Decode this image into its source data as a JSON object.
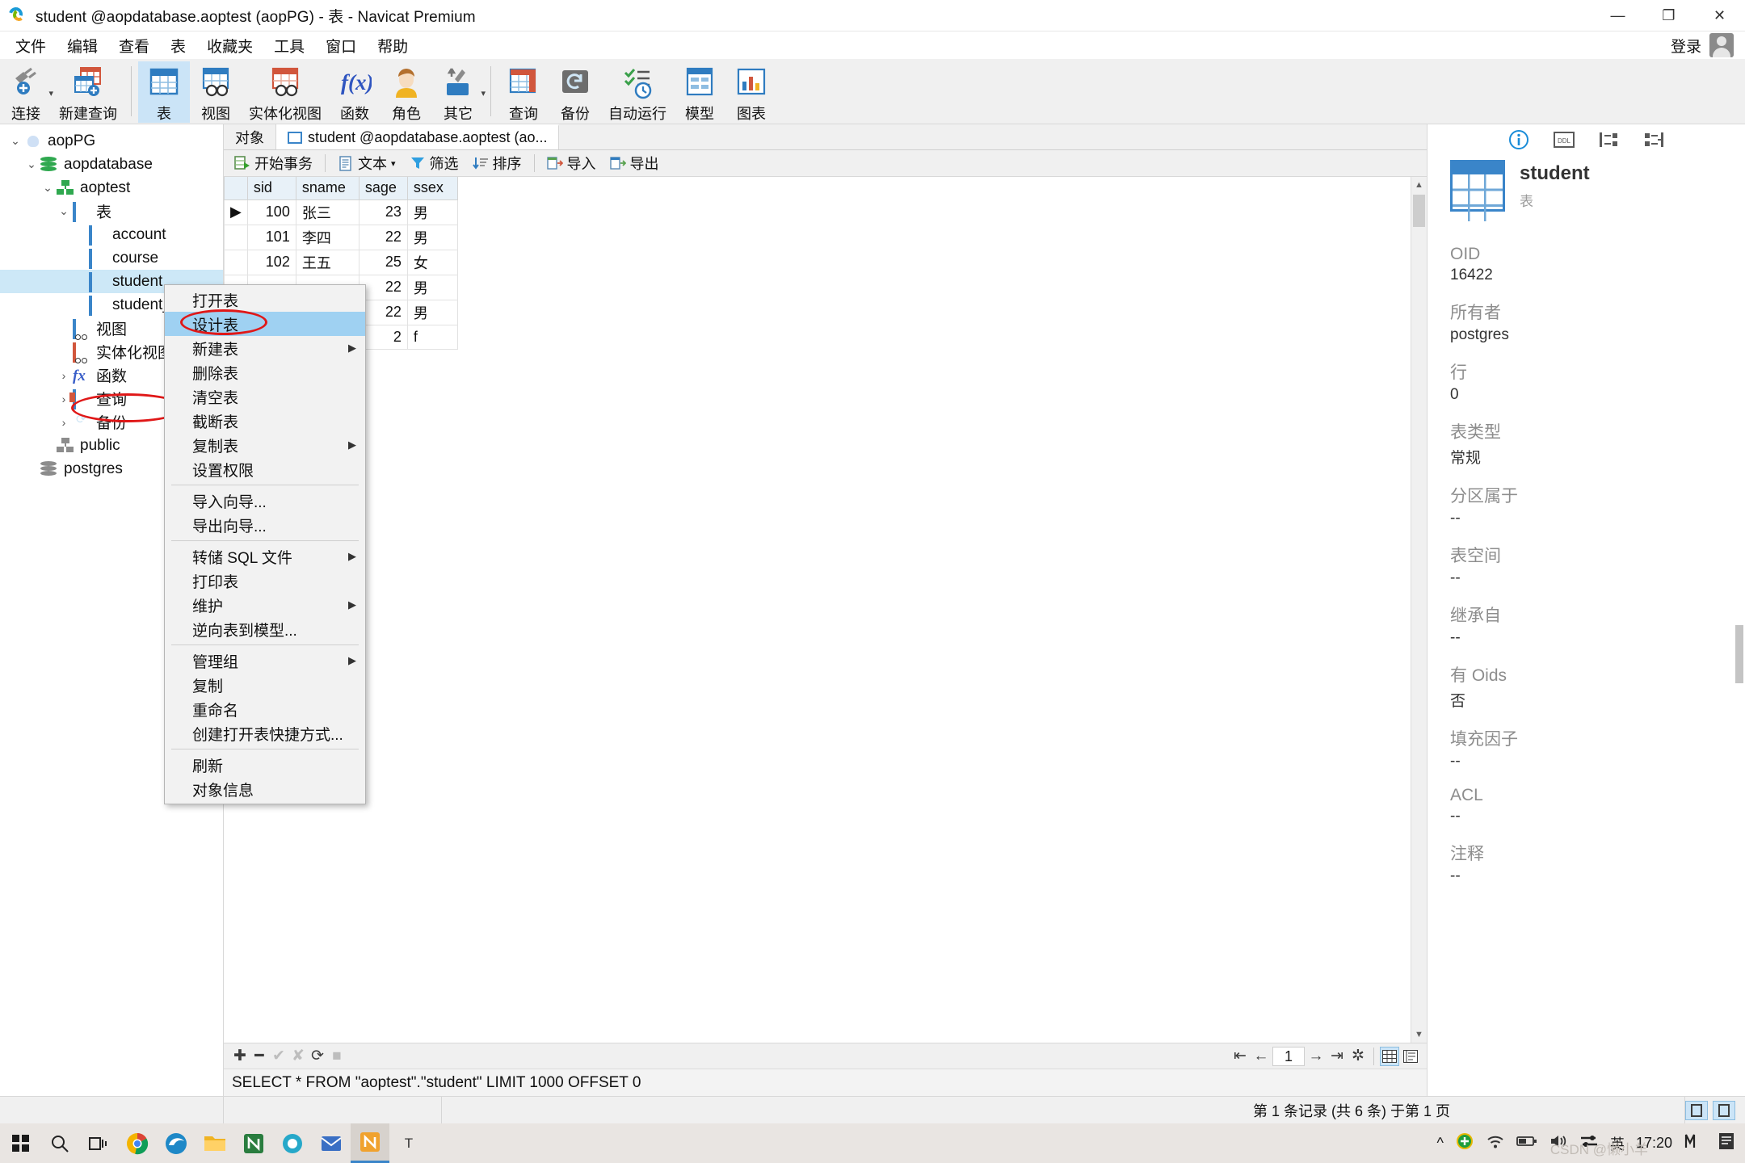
{
  "window": {
    "title": "student @aopdatabase.aoptest (aopPG) - 表 - Navicat Premium",
    "minimize": "—",
    "maximize": "❐",
    "close": "✕"
  },
  "menubar": {
    "items": [
      "文件",
      "编辑",
      "查看",
      "表",
      "收藏夹",
      "工具",
      "窗口",
      "帮助"
    ],
    "login_label": "登录"
  },
  "ribbon": {
    "items": [
      {
        "label": "连接",
        "icon": "connect-icon",
        "caret": true
      },
      {
        "label": "新建查询",
        "icon": "new-query-icon",
        "caret": false
      },
      {
        "label": "表",
        "icon": "table-icon",
        "caret": false,
        "active": true
      },
      {
        "label": "视图",
        "icon": "view-icon",
        "caret": false
      },
      {
        "label": "实体化视图",
        "icon": "materialized-view-icon",
        "caret": false
      },
      {
        "label": "函数",
        "icon": "function-icon",
        "caret": false
      },
      {
        "label": "角色",
        "icon": "role-icon",
        "caret": false
      },
      {
        "label": "其它",
        "icon": "other-tools-icon",
        "caret": true
      },
      {
        "label": "查询",
        "icon": "query-icon",
        "caret": false
      },
      {
        "label": "备份",
        "icon": "backup-icon",
        "caret": false
      },
      {
        "label": "自动运行",
        "icon": "automation-icon",
        "caret": false
      },
      {
        "label": "模型",
        "icon": "model-icon",
        "caret": false
      },
      {
        "label": "图表",
        "icon": "chart-icon",
        "caret": false
      }
    ]
  },
  "sidebar": {
    "nodes": [
      {
        "label": "aopPG",
        "indent": 0,
        "twisty": "⌄",
        "icon": "postgres-server-icon"
      },
      {
        "label": "aopdatabase",
        "indent": 1,
        "twisty": "⌄",
        "icon": "database-icon"
      },
      {
        "label": "aoptest",
        "indent": 2,
        "twisty": "⌄",
        "icon": "schema-icon"
      },
      {
        "label": "表",
        "indent": 3,
        "twisty": "⌄",
        "icon": "tables-folder-icon"
      },
      {
        "label": "account",
        "indent": 4,
        "twisty": "",
        "icon": "table-icon"
      },
      {
        "label": "course",
        "indent": 4,
        "twisty": "",
        "icon": "table-icon"
      },
      {
        "label": "student",
        "indent": 4,
        "twisty": "",
        "icon": "table-icon",
        "selected": true
      },
      {
        "label": "student_",
        "indent": 4,
        "twisty": "",
        "icon": "table-icon"
      },
      {
        "label": "视图",
        "indent": 3,
        "twisty": "",
        "icon": "view-icon"
      },
      {
        "label": "实体化视图",
        "indent": 3,
        "twisty": "",
        "icon": "materialized-view-icon"
      },
      {
        "label": "函数",
        "indent": 3,
        "twisty": "›",
        "icon": "function-icon"
      },
      {
        "label": "查询",
        "indent": 3,
        "twisty": "›",
        "icon": "query-icon"
      },
      {
        "label": "备份",
        "indent": 3,
        "twisty": "›",
        "icon": "backup-icon"
      },
      {
        "label": "public",
        "indent": 2,
        "twisty": "",
        "icon": "schema-gray-icon"
      },
      {
        "label": "postgres",
        "indent": 1,
        "twisty": "",
        "icon": "database-gray-icon"
      }
    ]
  },
  "tabs": [
    {
      "label": "对象",
      "icon": "",
      "active": false
    },
    {
      "label": "student @aopdatabase.aoptest (ao...",
      "icon": "table-icon",
      "active": true
    }
  ],
  "grid_toolbar": {
    "buttons": [
      {
        "label": "开始事务",
        "icon": "transaction-icon",
        "caret": false
      },
      {
        "label": "文本",
        "icon": "text-icon",
        "caret": true
      },
      {
        "label": "筛选",
        "icon": "filter-icon",
        "caret": false
      },
      {
        "label": "排序",
        "icon": "sort-icon",
        "caret": false
      },
      {
        "label": "导入",
        "icon": "import-icon",
        "caret": false
      },
      {
        "label": "导出",
        "icon": "export-icon",
        "caret": false
      }
    ]
  },
  "data_grid": {
    "columns": [
      "sid",
      "sname",
      "sage",
      "ssex"
    ],
    "rows": [
      {
        "marker": "▶",
        "sid": "100",
        "sname": "张三",
        "sage": "23",
        "ssex": "男"
      },
      {
        "marker": "",
        "sid": "101",
        "sname": "李四",
        "sage": "22",
        "ssex": "男"
      },
      {
        "marker": "",
        "sid": "102",
        "sname": "王五",
        "sage": "25",
        "ssex": "女"
      },
      {
        "marker": "",
        "sid": "",
        "sname": "",
        "sage": "22",
        "ssex": "男"
      },
      {
        "marker": "",
        "sid": "",
        "sname": "",
        "sage": "22",
        "ssex": "男"
      },
      {
        "marker": "",
        "sid": "",
        "sname": "",
        "sage": "2",
        "ssex": "f"
      }
    ]
  },
  "context_menu": {
    "items": [
      {
        "label": "打开表",
        "submenu": false,
        "highlight": false
      },
      {
        "label": "设计表",
        "submenu": false,
        "highlight": true
      },
      {
        "label": "新建表",
        "submenu": true,
        "highlight": false
      },
      {
        "label": "删除表",
        "submenu": false,
        "highlight": false
      },
      {
        "label": "清空表",
        "submenu": false,
        "highlight": false
      },
      {
        "label": "截断表",
        "submenu": false,
        "highlight": false
      },
      {
        "label": "复制表",
        "submenu": true,
        "highlight": false
      },
      {
        "label": "设置权限",
        "submenu": false,
        "highlight": false
      },
      {
        "separator": true
      },
      {
        "label": "导入向导...",
        "submenu": false,
        "highlight": false
      },
      {
        "label": "导出向导...",
        "submenu": false,
        "highlight": false
      },
      {
        "separator": true
      },
      {
        "label": "转储 SQL 文件",
        "submenu": true,
        "highlight": false
      },
      {
        "label": "打印表",
        "submenu": false,
        "highlight": false
      },
      {
        "label": "维护",
        "submenu": true,
        "highlight": false
      },
      {
        "label": "逆向表到模型...",
        "submenu": false,
        "highlight": false
      },
      {
        "separator": true
      },
      {
        "label": "管理组",
        "submenu": true,
        "highlight": false
      },
      {
        "label": "复制",
        "submenu": false,
        "highlight": false
      },
      {
        "label": "重命名",
        "submenu": false,
        "highlight": false
      },
      {
        "label": "创建打开表快捷方式...",
        "submenu": false,
        "highlight": false
      },
      {
        "separator": true
      },
      {
        "label": "刷新",
        "submenu": false,
        "highlight": false
      },
      {
        "label": "对象信息",
        "submenu": false,
        "highlight": false
      }
    ]
  },
  "info_panel": {
    "tabs": [
      "info-icon",
      "ddl-icon",
      "structure-icon",
      "relation-icon"
    ],
    "name": "student",
    "subtitle": "表",
    "fields": [
      {
        "key": "OID",
        "value": "16422"
      },
      {
        "key": "所有者",
        "value": "postgres"
      },
      {
        "key": "行",
        "value": "0"
      },
      {
        "key": "表类型",
        "value": "常规"
      },
      {
        "key": "分区属于",
        "value": "--"
      },
      {
        "key": "表空间",
        "value": "--"
      },
      {
        "key": "继承自",
        "value": "--"
      },
      {
        "key": "有 Oids",
        "value": "否"
      },
      {
        "key": "填充因子",
        "value": "--"
      },
      {
        "key": "ACL",
        "value": "--"
      },
      {
        "key": "注释",
        "value": "--"
      }
    ]
  },
  "grid_bottom": {
    "left_icons": [
      "add-record-icon",
      "delete-record-icon",
      "confirm-icon",
      "cancel-icon",
      "refresh-icon",
      "stop-icon"
    ],
    "page_value": "1",
    "nav_icons": [
      "first-page-icon",
      "prev-page-icon",
      "next-page-icon",
      "last-page-icon",
      "settings-icon"
    ],
    "view_icons": [
      "grid-view-icon",
      "form-view-icon"
    ]
  },
  "sql_preview": "SELECT * FROM \"aoptest\".\"student\" LIMIT 1000 OFFSET 0",
  "status_bar": {
    "record_info": "第 1 条记录 (共 6 条) 于第 1 页"
  },
  "taskbar": {
    "buttons": [
      "start-icon",
      "search-icon",
      "task-view-icon",
      "chrome-icon",
      "edge-icon",
      "file-explorer-icon",
      "navicat-icon",
      "app-icon",
      "mail-icon",
      "navicat-active-icon",
      "text-icon"
    ],
    "tray": {
      "chevron": "^",
      "shield": "shield-icon",
      "wifi": "wifi-icon",
      "battery": "battery-icon",
      "volume": "volume-icon",
      "network": "network-icon",
      "ime": "英",
      "time": "17:20"
    }
  },
  "watermark": "CSDN @懒小羊"
}
